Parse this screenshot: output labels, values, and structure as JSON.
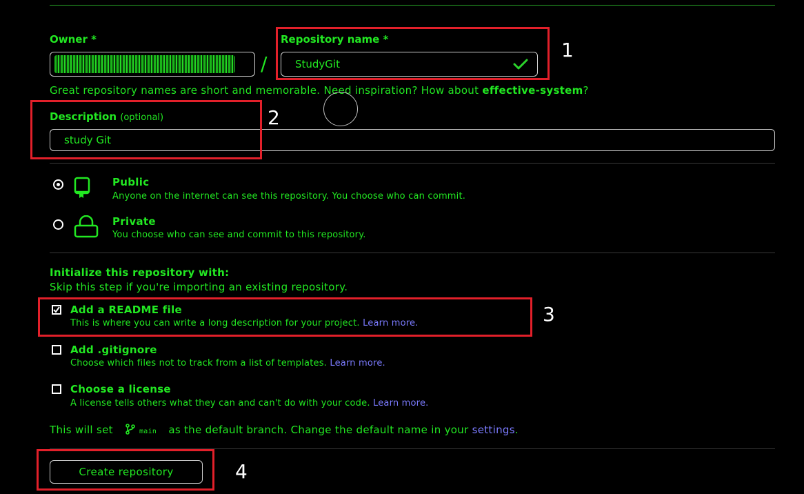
{
  "owner": {
    "label": "Owner *",
    "separator": "/"
  },
  "repository_name": {
    "label": "Repository name *",
    "value": "StudyGit"
  },
  "name_hint": {
    "prefix": "Great repository names are short and memorable. Need inspiration? How about",
    "suggestion": "effective-system",
    "suffix": "?"
  },
  "description": {
    "label": "Description",
    "optional": "(optional)",
    "value": "study Git"
  },
  "visibility": {
    "public": {
      "title": "Public",
      "desc": "Anyone on the internet can see this repository. You choose who can commit.",
      "selected": true
    },
    "private": {
      "title": "Private",
      "desc": "You choose who can see and commit to this repository.",
      "selected": false
    }
  },
  "initialize": {
    "heading": "Initialize this repository with:",
    "subheading": "Skip this step if you're importing an existing repository.",
    "readme": {
      "title": "Add a README file",
      "desc": "This is where you can write a long description for your project.",
      "link": "Learn more.",
      "checked": true
    },
    "gitignore": {
      "title": "Add .gitignore",
      "desc": "Choose which files not to track from a list of templates.",
      "link": "Learn more.",
      "checked": false
    },
    "license": {
      "title": "Choose a license",
      "desc": "A license tells others what they can and can't do with your code.",
      "link": "Learn more.",
      "checked": false
    }
  },
  "branch_note": {
    "prefix": "This will set",
    "branch": "main",
    "middle": "as the default branch. Change the default name in your",
    "link": "settings",
    "suffix": "."
  },
  "create_button": "Create repository",
  "annotations": [
    "1",
    "2",
    "3",
    "4"
  ],
  "colors": {
    "text": "#22e822",
    "link": "#7b7bff",
    "annotation_box": "#e2202a"
  }
}
